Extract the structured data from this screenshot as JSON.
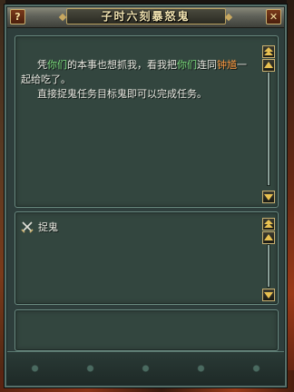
{
  "window": {
    "title": "子时六刻暴怒鬼",
    "help_label": "?",
    "close_label": "✕"
  },
  "dialog": {
    "line1_a": "凭",
    "line1_b": "你们",
    "line1_c": "的本事也想抓我，看我把",
    "line1_d": "你们",
    "line1_e": "连同",
    "line1_f": "钟馗",
    "line1_g": "一",
    "line2": "起给吃了。",
    "line3": "直接捉鬼任务目标鬼即可以完成任务。"
  },
  "quest": {
    "items": [
      {
        "label": "捉鬼",
        "icon": "crossed-swords-icon"
      }
    ]
  },
  "colors": {
    "panel": "#33463f",
    "highlight_green": "#7ee07e",
    "highlight_orange": "#ff9a40",
    "gold_border": "#c8b070"
  }
}
